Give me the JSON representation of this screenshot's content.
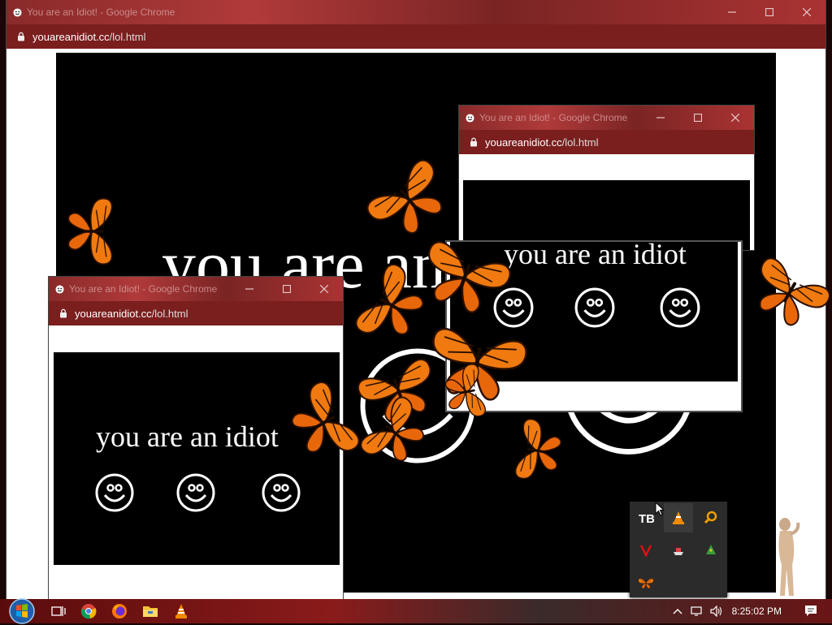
{
  "window": {
    "title": "You are an Idiot! - Google Chrome",
    "host": "youareanidiot.cc",
    "path": "/lol.html"
  },
  "popup_right": {
    "title": "You are an Idiot! - Google Chrome",
    "host": "youareanidiot.cc",
    "path": "/lol.html",
    "message": "you are an idiot"
  },
  "popup_left": {
    "title": "You are an Idiot! - Google Chrome",
    "host": "youareanidiot.cc",
    "path": "/lol.html",
    "message": "you are an idiot"
  },
  "main_message": "you are an idiot",
  "taskbar": {
    "icons": [
      "start-orb-icon",
      "task-view-icon",
      "chrome-icon",
      "firefox-icon",
      "file-explorer-icon",
      "vlc-icon"
    ],
    "clock": "8:25:02 PM"
  },
  "tray_icons": [
    "tb-icon",
    "vlc-icon",
    "search-tool-icon",
    "v-icon",
    "ship-icon",
    "tree-icon",
    "butterfly-icon"
  ],
  "colors": {
    "chrome_red": "#7a1e1e",
    "title_red": "#8a2a2a",
    "butterfly": "#f07a10",
    "stage": "#000000"
  }
}
